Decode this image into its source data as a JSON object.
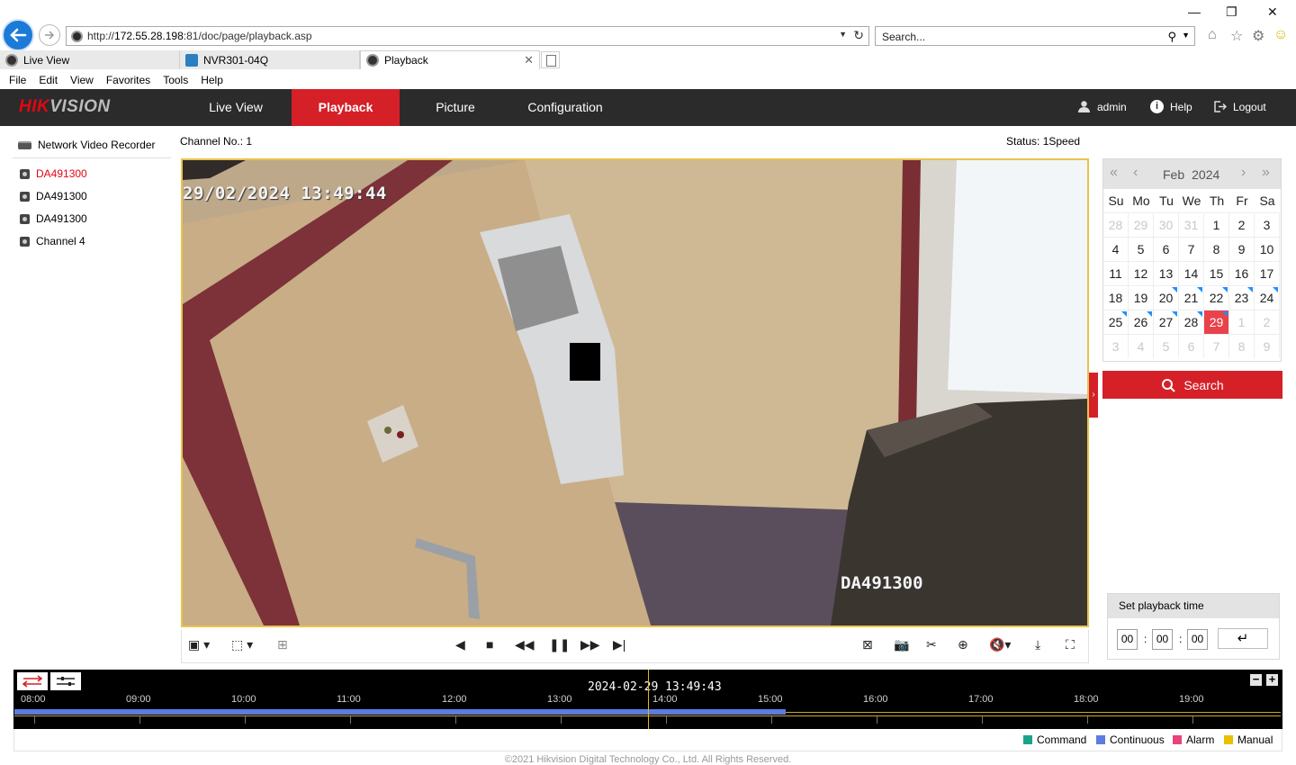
{
  "browser": {
    "url_prefix": "http://",
    "url_host": "172.55.28.198",
    "url_rest": ":81/doc/page/playback.asp",
    "search_placeholder": "Search...",
    "tabs": [
      {
        "label": "Live View"
      },
      {
        "label": "NVR301-04Q"
      },
      {
        "label": "Playback"
      }
    ],
    "menu": [
      "File",
      "Edit",
      "View",
      "Favorites",
      "Tools",
      "Help"
    ]
  },
  "app": {
    "logo_main": "HIK",
    "logo_accent": "VISION",
    "nav": [
      {
        "label": "Live View"
      },
      {
        "label": "Playback"
      },
      {
        "label": "Picture"
      },
      {
        "label": "Configuration"
      }
    ],
    "user": "admin",
    "help": "Help",
    "logout": "Logout",
    "accent_color": "#d52028"
  },
  "tree": {
    "root": "Network Video Recorder",
    "channels": [
      "DA491300",
      "DA491300",
      "DA491300",
      "Channel 4"
    ]
  },
  "player": {
    "channel_label": "Channel No.: 1",
    "status_label": "Status: 1Speed",
    "osd_time": "29/02/2024 13:49:44",
    "osd_name": "DA491300"
  },
  "calendar": {
    "month": "Feb",
    "year": "2024",
    "dow": [
      "Su",
      "Mo",
      "Tu",
      "We",
      "Th",
      "Fr",
      "Sa"
    ],
    "days": [
      {
        "d": "28",
        "dim": true
      },
      {
        "d": "29",
        "dim": true
      },
      {
        "d": "30",
        "dim": true
      },
      {
        "d": "31",
        "dim": true
      },
      {
        "d": "1"
      },
      {
        "d": "2"
      },
      {
        "d": "3"
      },
      {
        "d": "4"
      },
      {
        "d": "5"
      },
      {
        "d": "6"
      },
      {
        "d": "7"
      },
      {
        "d": "8"
      },
      {
        "d": "9"
      },
      {
        "d": "10"
      },
      {
        "d": "11"
      },
      {
        "d": "12"
      },
      {
        "d": "13"
      },
      {
        "d": "14"
      },
      {
        "d": "15"
      },
      {
        "d": "16"
      },
      {
        "d": "17"
      },
      {
        "d": "18"
      },
      {
        "d": "19"
      },
      {
        "d": "20",
        "rec": true
      },
      {
        "d": "21",
        "rec": true
      },
      {
        "d": "22",
        "rec": true
      },
      {
        "d": "23",
        "rec": true
      },
      {
        "d": "24",
        "rec": true
      },
      {
        "d": "25",
        "rec": true
      },
      {
        "d": "26",
        "rec": true
      },
      {
        "d": "27",
        "rec": true
      },
      {
        "d": "28",
        "rec": true
      },
      {
        "d": "29",
        "rec": true,
        "today": true
      },
      {
        "d": "1",
        "dim": true
      },
      {
        "d": "2",
        "dim": true
      },
      {
        "d": "3",
        "dim": true
      },
      {
        "d": "4",
        "dim": true
      },
      {
        "d": "5",
        "dim": true
      },
      {
        "d": "6",
        "dim": true
      },
      {
        "d": "7",
        "dim": true
      },
      {
        "d": "8",
        "dim": true
      },
      {
        "d": "9",
        "dim": true
      }
    ],
    "search_label": "Search"
  },
  "playback_time": {
    "title": "Set playback time",
    "hh": "00",
    "mm": "00",
    "ss": "00"
  },
  "timeline": {
    "current": "2024-02-29 13:49:43",
    "hours": [
      "08:00",
      "09:00",
      "10:00",
      "11:00",
      "12:00",
      "13:00",
      "14:00",
      "15:00",
      "16:00",
      "17:00",
      "18:00",
      "19:00"
    ],
    "record_until_fraction": 0.609
  },
  "legend": [
    {
      "label": "Command",
      "color": "#1aa38c"
    },
    {
      "label": "Continuous",
      "color": "#5d7ce0"
    },
    {
      "label": "Alarm",
      "color": "#e8447a"
    },
    {
      "label": "Manual",
      "color": "#e8c000"
    }
  ],
  "copyright": "©2021 Hikvision Digital Technology Co., Ltd. All Rights Reserved."
}
